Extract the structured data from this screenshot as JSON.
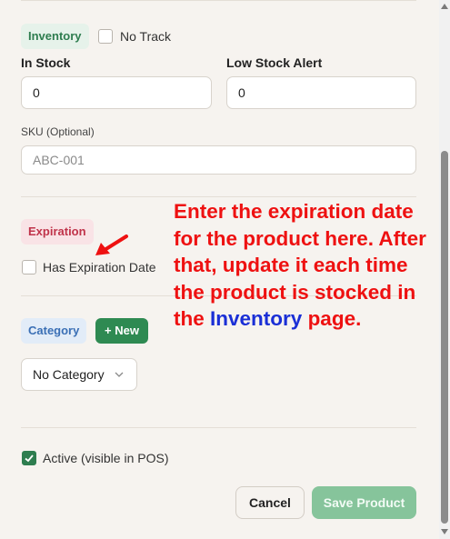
{
  "inventory": {
    "section_label": "Inventory",
    "no_track_label": "No Track",
    "in_stock_label": "In Stock",
    "in_stock_value": "0",
    "low_stock_label": "Low Stock Alert",
    "low_stock_value": "0",
    "sku_label": "SKU (Optional)",
    "sku_placeholder": "ABC-001"
  },
  "expiration": {
    "section_label": "Expiration",
    "checkbox_label": "Has Expiration Date"
  },
  "category": {
    "section_label": "Category",
    "new_button": "+ New",
    "select_value": "No Category"
  },
  "active": {
    "checkbox_label": "Active (visible in POS)",
    "checked": true
  },
  "footer": {
    "cancel_label": "Cancel",
    "save_label": "Save Product"
  },
  "annotation": {
    "text_before": "Enter the expiration date for the product here. After that, update it each time the product is stocked in the",
    "highlight": "Inventory",
    "text_after": "page."
  },
  "colors": {
    "accent_green": "#2e8a52",
    "annotation_red": "#ee1111",
    "annotation_blue": "#1a2fd6"
  }
}
